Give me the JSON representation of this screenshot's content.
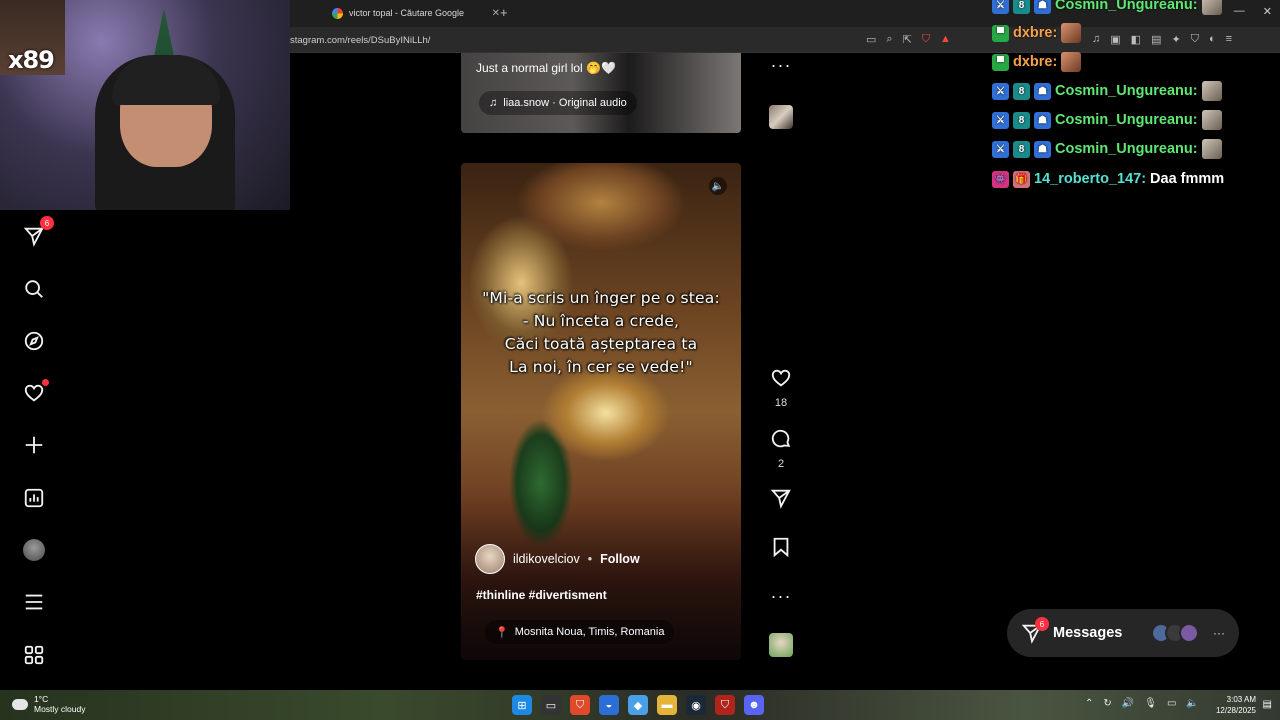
{
  "browser": {
    "tab_title": "victor topal - Căutare Google",
    "new_tab": "+",
    "url": "stagram.com/reels/DSuByINiLLh/",
    "window": {
      "minimize": "—",
      "close": "✕"
    }
  },
  "webcam": {
    "overlay_text": "x89"
  },
  "sidebar": {
    "items": [
      {
        "name": "direct",
        "icon": "send-icon",
        "badge": "6"
      },
      {
        "name": "search",
        "icon": "search-icon"
      },
      {
        "name": "explore",
        "icon": "compass-icon"
      },
      {
        "name": "notifications",
        "icon": "heart-icon",
        "dot": true
      },
      {
        "name": "create",
        "icon": "plus-icon"
      },
      {
        "name": "dashboard",
        "icon": "chart-icon"
      },
      {
        "name": "profile",
        "icon": "avatar-icon"
      },
      {
        "name": "more",
        "icon": "menu-icon"
      },
      {
        "name": "apps",
        "icon": "grid-icon"
      }
    ]
  },
  "previous_reel": {
    "caption": "Just a normal girl lol 🤭🤍",
    "audio": "liaa.snow · Original audio"
  },
  "reel": {
    "quote_lines": [
      "\"Mi-a scris un înger pe o stea:",
      "- Nu înceta a crede,",
      "Căci toată așteptarea ta",
      "La noi, în cer se vede!\""
    ],
    "username": "ildikovelciov",
    "separator": "•",
    "follow_label": "Follow",
    "hashtags": "#thinline #divertisment",
    "location": "Mosnita Noua, Timis, Romania",
    "likes": "18",
    "comments": "2"
  },
  "chat": {
    "messages": [
      {
        "user": "Cosmin_Ungureanu:",
        "text": "",
        "color": "#5ee872"
      },
      {
        "user": "dxbre:",
        "text": "",
        "color": "#f5a04a"
      },
      {
        "user": "dxbre:",
        "text": "",
        "color": "#f5a04a"
      },
      {
        "user": "Cosmin_Ungureanu:",
        "text": "",
        "color": "#5ee872"
      },
      {
        "user": "Cosmin_Ungureanu:",
        "text": "",
        "color": "#5ee872"
      },
      {
        "user": "Cosmin_Ungureanu:",
        "text": "",
        "color": "#5ee872"
      },
      {
        "user": "14_roberto_147:",
        "text": "Daa fmmm",
        "color": "#56e0d2"
      }
    ]
  },
  "messages_panel": {
    "label": "Messages",
    "badge": "6",
    "more": "···"
  },
  "taskbar": {
    "temp": "1°C",
    "weather": "Mostly cloudy",
    "time": "3:03 AM",
    "date": "12/28/2025"
  }
}
